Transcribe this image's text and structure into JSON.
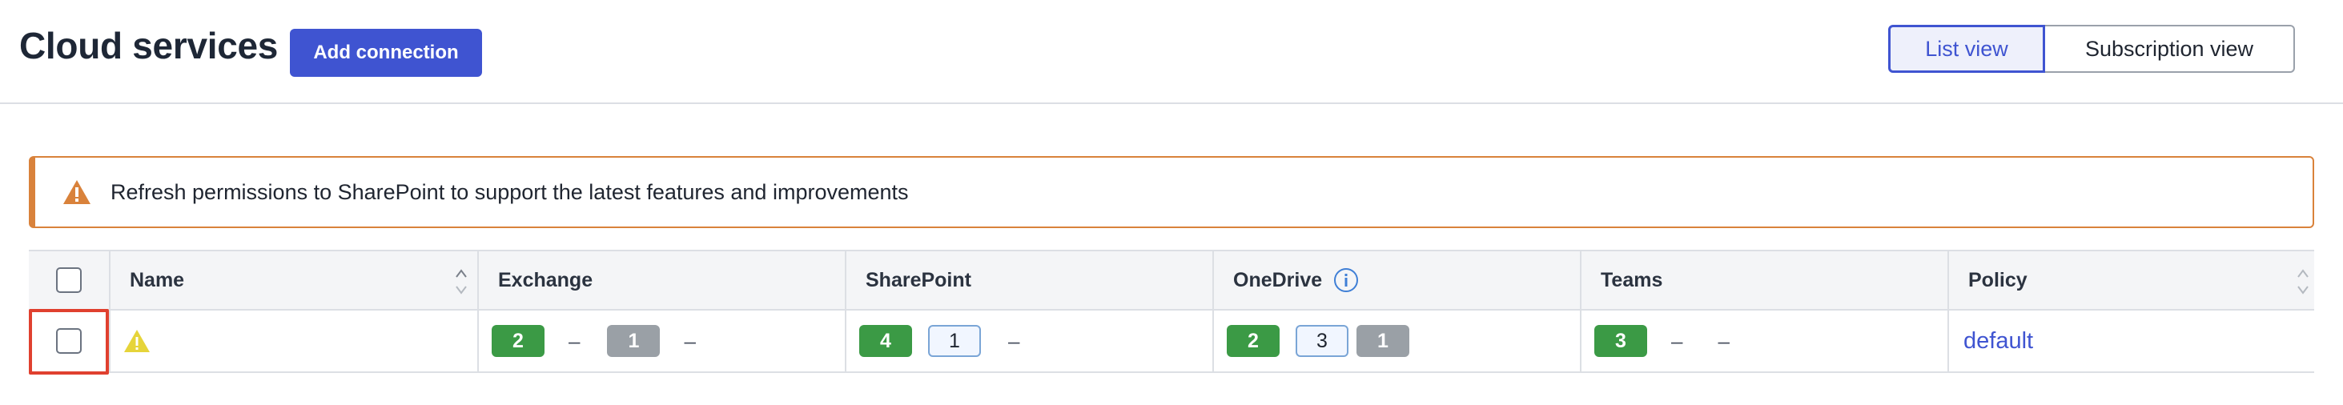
{
  "header": {
    "title": "Cloud services",
    "add_button": "Add connection",
    "views": [
      {
        "label": "List view",
        "selected": true
      },
      {
        "label": "Subscription view",
        "selected": false
      }
    ]
  },
  "alert": {
    "icon": "warning-icon",
    "text": "Refresh permissions to SharePoint to support the latest features and improvements",
    "color": "#d9823b"
  },
  "table": {
    "columns": [
      "Name",
      "Exchange",
      "SharePoint",
      "OneDrive",
      "Teams",
      "Policy"
    ],
    "rows": [
      {
        "name_status_icon": "warning-icon",
        "exchange": {
          "green": "2",
          "gray": "1"
        },
        "sharepoint": {
          "green": "4",
          "outline": "1"
        },
        "onedrive": {
          "green": "2",
          "outline": "3",
          "gray": "1"
        },
        "teams": {
          "green": "3"
        },
        "policy": "default"
      }
    ]
  },
  "colors": {
    "primary": "#3f54d1",
    "success": "#3b9a45",
    "neutral": "#9aa0a6",
    "warning": "#d9823b",
    "focus": "#e0402f"
  }
}
